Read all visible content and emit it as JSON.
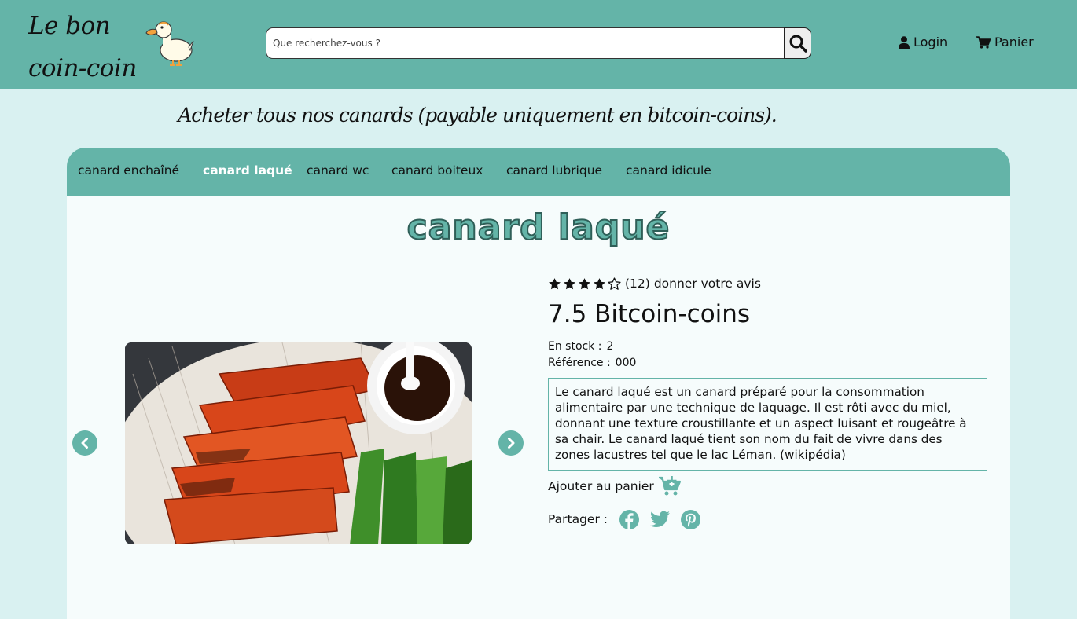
{
  "site": {
    "logo_line1": "Le bon",
    "logo_line2": "coin-coin",
    "tagline": "Acheter tous nos canards (payable uniquement en bitcoin-coins)."
  },
  "header": {
    "search_placeholder": "Que recherchez-vous ?",
    "login_label": "Login",
    "cart_label": "Panier"
  },
  "categories": [
    {
      "label": "canard enchaîné",
      "active": false
    },
    {
      "label": "canard laqué",
      "active": true
    },
    {
      "label": "canard wc",
      "active": false
    },
    {
      "label": "canard boiteux",
      "active": false
    },
    {
      "label": "canard lubrique",
      "active": false
    },
    {
      "label": "canard idicule",
      "active": false
    }
  ],
  "product": {
    "title": "canard laqué",
    "rating": 4,
    "rating_max": 5,
    "review_count": "(12)",
    "review_link": "donner votre avis",
    "price": "7.5 Bitcoin-coins",
    "stock_label": "En stock :",
    "stock_value": "2",
    "ref_label": "Référence :",
    "ref_value": "000",
    "description": "Le canard laqué est un canard préparé pour la consommation alimentaire par une technique de laquage. Il est rôti avec du miel, donnant une texture croustillante et un aspect luisant et rougeâtre à sa chair. Le canard laqué tient son nom du fait de vivre dans des zones lacustres tel que le lac Léman. (wikipédia)",
    "add_to_cart": "Ajouter au panier",
    "share_label": "Partager :"
  },
  "colors": {
    "accent": "#64b4a8",
    "background": "#d9f1f1",
    "card": "#f6fcfc"
  },
  "icons": [
    "search-icon",
    "user-icon",
    "cart-icon",
    "chevron-left-icon",
    "chevron-right-icon",
    "star-icon",
    "cart-plus-icon",
    "facebook-icon",
    "twitter-icon",
    "pinterest-icon"
  ]
}
